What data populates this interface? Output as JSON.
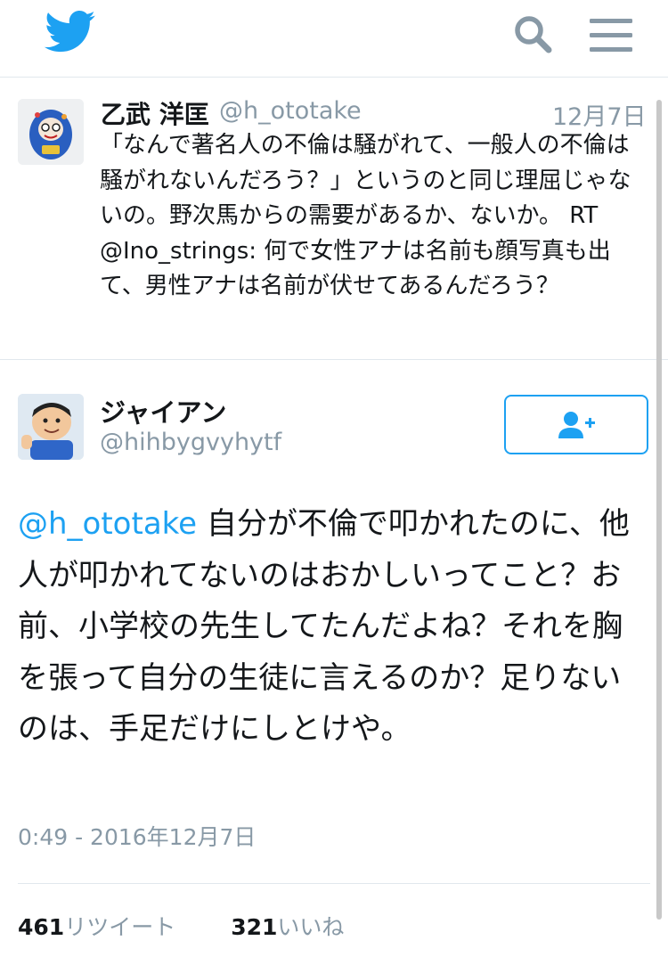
{
  "header": {
    "logo": "twitter-bird-icon",
    "search_icon": "search-icon",
    "menu_icon": "hamburger-menu-icon",
    "accent_color": "#1da1f2"
  },
  "quoted_tweet": {
    "author_name": "乙武 洋匡",
    "handle": "@h_ototake",
    "date": "12月7日",
    "text": "「なんで著名人の不倫は騒がれて、一般人の不倫は騒がれないんだろう？」というのと同じ理屈じゃないの。野次馬からの需要があるか、ないか。 RT @Ino_strings: 何で女性アナは名前も顔写真も出て、男性アナは名前が伏せてあるんだろう？"
  },
  "main_tweet": {
    "author_name": "ジャイアン",
    "handle": "@hihbygvyhytf",
    "follow_icon": "follow-user-plus-icon",
    "mention": "@h_ototake",
    "text": " 自分が不倫で叩かれたのに、他人が叩かれてないのはおかしいってこと？お前、小学校の先生してたんだよね？それを胸を張って自分の生徒に言えるのか？足りないのは、手足だけにしとけや。",
    "timestamp": "0:49 - 2016年12月7日",
    "retweet_count": "461",
    "retweet_label": "リツイート",
    "like_count": "321",
    "like_label": "いいね"
  }
}
